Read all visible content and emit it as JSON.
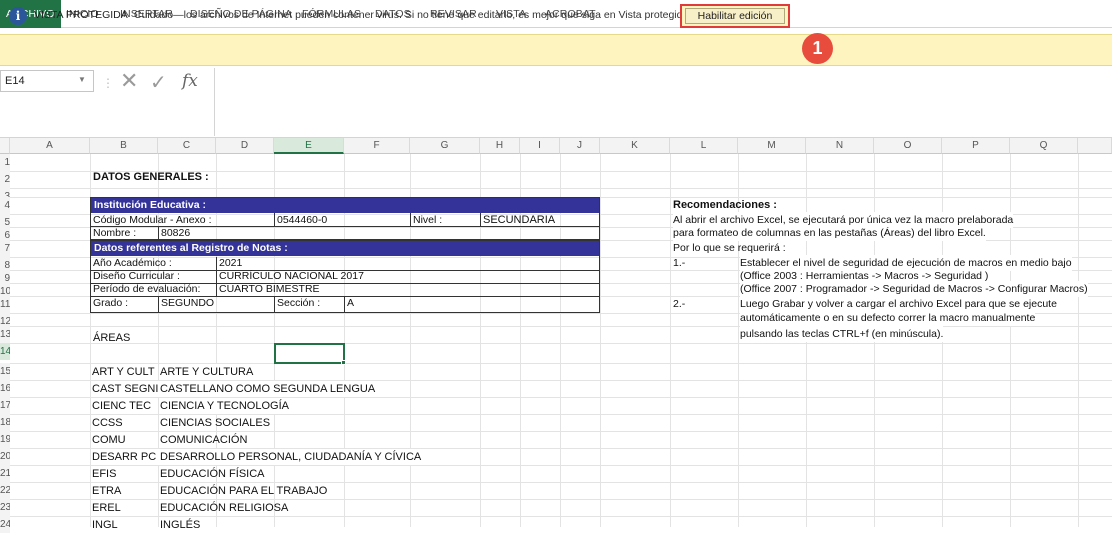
{
  "ribbon": {
    "tabs": [
      "ARCHIVO",
      "INICIO",
      "INSERTAR",
      "DISEÑO DE PÁGINA",
      "FÓRMULAS",
      "DATOS",
      "REVISAR",
      "VISTA",
      "ACROBAT"
    ],
    "active": "ARCHIVO",
    "accent": "#217346"
  },
  "protected_view": {
    "title": "VISTA PROTEGIDA",
    "message": "Cuidado—los archivos de Internet pueden contener virus. Si no tiene que editarlo, es mejor que siga en Vista protegida.",
    "button": "Habilitar edición",
    "badge": "1",
    "icon": "info-icon"
  },
  "formula_bar": {
    "name_box": "E14",
    "fx": "fx",
    "value": ""
  },
  "columns": [
    "A",
    "B",
    "C",
    "D",
    "E",
    "F",
    "G",
    "H",
    "I",
    "J",
    "K",
    "L",
    "M",
    "N",
    "O",
    "P",
    "Q"
  ],
  "selected_column": "E",
  "rows": [
    "1",
    "2",
    "3",
    "4",
    "5",
    "6",
    "7",
    "8",
    "9",
    "10",
    "11",
    "12",
    "13",
    "14",
    "15",
    "16",
    "17",
    "18",
    "19",
    "20",
    "21",
    "22",
    "23",
    "24"
  ],
  "selected_row": "14",
  "sheet": {
    "datos_generales": "DATOS GENERALES :",
    "institucion_header": "Institución Educativa :",
    "codigo_label": "Código Modular - Anexo :",
    "codigo_value": "0544460-0",
    "nivel_label": "Nivel :",
    "nivel_value": "SECUNDARIA",
    "nombre_label": "Nombre :",
    "nombre_value": "80826",
    "registro_header": "Datos referentes al Registro de Notas :",
    "anio_label": "Año Académico :",
    "anio_value": "2021",
    "diseno_label": "Diseño Curricular :",
    "diseno_value": "CURRÍCULO NACIONAL 2017",
    "periodo_label": "Período de evaluación:",
    "periodo_value": "CUARTO BIMESTRE",
    "grado_label": "Grado :",
    "grado_value": "SEGUNDO",
    "seccion_label": "Sección :",
    "seccion_value": "A",
    "areas_label": "ÁREAS",
    "areas": [
      {
        "code": "ART Y CULT",
        "name": "ARTE Y CULTURA"
      },
      {
        "code": "CAST SEGNI",
        "name": "CASTELLANO COMO SEGUNDA LENGUA"
      },
      {
        "code": "CIENC TEC",
        "name": "CIENCIA Y TECNOLOGÍA"
      },
      {
        "code": "CCSS",
        "name": "CIENCIAS SOCIALES"
      },
      {
        "code": "COMU",
        "name": "COMUNICACIÓN"
      },
      {
        "code": "DESARR PC",
        "name": "DESARROLLO PERSONAL, CIUDADANÍA Y CÍVICA"
      },
      {
        "code": "EFIS",
        "name": "EDUCACIÓN FÍSICA"
      },
      {
        "code": "ETRA",
        "name": "EDUCACIÓN PARA EL TRABAJO"
      },
      {
        "code": "EREL",
        "name": "EDUCACIÓN RELIGIOSA"
      },
      {
        "code": "INGL",
        "name": "INGLÉS"
      }
    ],
    "recomendaciones": {
      "title": "Recomendaciones :",
      "line1": "Al abrir el archivo Excel, se ejecutará por única vez la macro prelaborada",
      "line2": "para formateo de columnas en las pestañas (Áreas) del libro Excel.",
      "line3": "Por lo que se requerirá :",
      "n1": "1.-",
      "s1a": "Establecer el nivel de seguridad de ejecución de macros en medio bajo",
      "s1b": "(Office 2003 : Herramientas -> Macros -> Seguridad )",
      "s1c": "(Office 2007 : Programador -> Seguridad de Macros -> Configurar Macros)",
      "n2": "2.-",
      "s2a": "Luego Grabar y volver a cargar el archivo Excel para que se ejecute",
      "s2b": "automáticamente o en su defecto correr la macro manualmente",
      "s2c": "pulsando las teclas CTRL+f (en minúscula)."
    }
  }
}
